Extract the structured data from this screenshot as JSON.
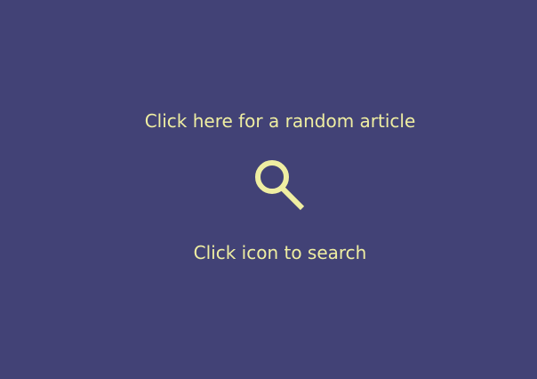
{
  "page": {
    "random_article_label": "Click here for a random article",
    "search_hint": "Click icon to search",
    "search_icon": "search-icon"
  },
  "colors": {
    "background": "#424276",
    "accent": "#EFEEA2"
  }
}
